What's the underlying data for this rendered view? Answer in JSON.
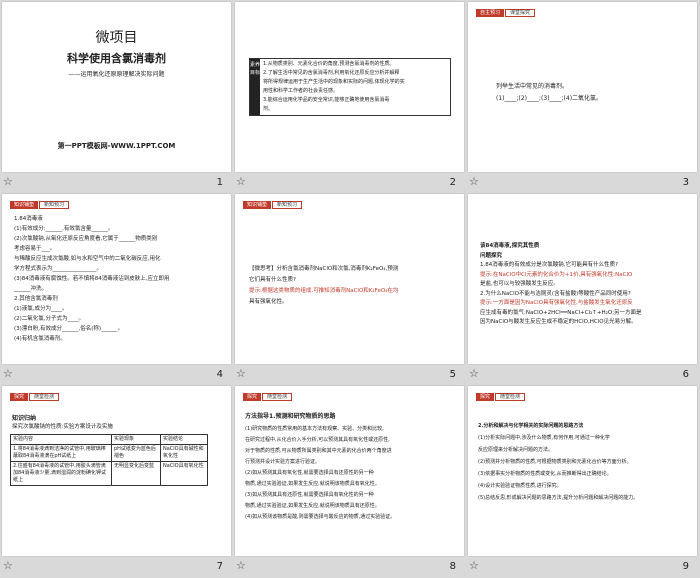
{
  "slides": [
    {
      "number": "1",
      "title": "微项目",
      "subtitle": "科学使用含氯消毒剂",
      "tagline": "——运用氧化还原原理解决实际问题",
      "footer": "第一PPT模板网-WWW.1PPT.COM"
    },
    {
      "number": "2",
      "side_label": "素养目标",
      "lines": [
        "1.从物质类别、元素化合价的角度,预测含氯消毒剂的性质。",
        "2.了解生活中常见的含氯消毒剂,利用氧化还原反应分析并解释",
        "将所得规律运用于生产生活中的现象和实际的问题,体现化学的实",
        "用性和科学工作者的社会责任感。",
        "3.能综合运用化学品的安全常识,能够正确地使用含氯消毒",
        "剂。"
      ]
    },
    {
      "number": "3",
      "tags": [
        "自主预习",
        "课堂探究"
      ],
      "lines": [
        "列举生活中常见的消毒剂。",
        "(1)____;(2)____;(3)____;(4)二氧化氯。"
      ]
    },
    {
      "number": "4",
      "tags": [
        "知识铺垫",
        "新知预习"
      ],
      "lines": [
        "1.84消毒液",
        "(1)有效成分:______,有效氯含量______。",
        "(2)次氯酸钠,从氧化还原反应角度看,它属于______物质类别",
        "考虑容易于___。",
        "与稀酸反应生成次氯酸,如与水和空气中的二氧化碳反应,用化",
        "学方程式表示为________________。",
        "(3)84消毒液有腐蚀性。若不慎将84消毒液沾到皮肤上,应立即用",
        "______冲洗。",
        "2.其他含氯消毒剂",
        "(1)液氯,成分为____。",
        "(2)二氧化氯,分子式为____。",
        "(3)漂白粉,有效成分______,俗名(称)______。",
        "(4)有机含氯消毒剂。"
      ]
    },
    {
      "number": "5",
      "tags": [
        "知识铺垫",
        "新知预习"
      ],
      "lines": [
        "【微思考】分析含氯消毒剂NaClO和次氯,消毒剂K₂FeO₄,预测",
        "它们具有什么性质?",
        "提示:根据这类物质的组成,可推知消毒剂NaClO和K₂FeO₄在均",
        "具有强氧化性。"
      ]
    },
    {
      "number": "6",
      "lines": [
        "该84消毒液,探究其性质",
        "问题探究",
        "1.84消毒液的有效成分是次氯酸钠,它可能具有什么性质?",
        "提示:在NaClO中Cl元素的化合价为+1价,具有强氧化性;NaClO",
        "是盐,也可以与较强酸发生反应。",
        "2.为什么NaClO不能与洁厕灵(含有盐酸)等酸性产品同时使用?",
        "提示:一方面是因为NaClO具有强氧化性,与盐酸发生氧化还原反",
        "应生成有毒的氯气:NaClO+2HCl══NaCl+Cl₂↑+H₂O;另一方面是",
        "因为NaClO与酸发生反应生成不稳定的HClO,HClO见光易分解。"
      ]
    },
    {
      "number": "7",
      "tags": [
        "探究",
        "随堂检测"
      ],
      "heading": "知识归纳",
      "subheading": "探究次氯酸钠的性质:实验方案设计及实施",
      "table": {
        "headers": [
          "实验内容",
          "实验现象",
          "实验结论"
        ],
        "rows": [
          [
            "1.将84消毒液滴到洁净的试管中,用玻璃棒蘸取84消毒液滴在pH试纸上",
            "pH试纸变为蓝色后褪色",
            "NaClO具有碱性和氧化性"
          ],
          [
            "2.往盛有84消毒液的试管中,用胶头滴管滴加84消毒液少量,滴到湿润的淀粉碘化钾试纸上",
            "无明显变化后变蓝",
            "NaClO具有氧化性"
          ]
        ]
      }
    },
    {
      "number": "8",
      "tags": [
        "探究",
        "随堂检测"
      ],
      "heading": "方法指导1.预测和研究物质的思路",
      "lines": [
        "(1)研究物质的性质常用的基本方法有观察、实验、分类和比较,",
        "在研究过程中,从化合价入手分析,可以预测其具有氧化性或还原性,",
        "对于物质的性质,可从物质所属类别和其中元素的化合价两个角度进",
        "行预测并设计实验方案进行验证。",
        "(2)如从预测其具有氧化性,就需要选择具有还原性的另一种",
        "物质,通过实验验证,如果发生反应,就说明该物质具有氧化性。",
        "(3)如从预测其具有还原性,就需要选择具有氧化性的另一种",
        "物质,通过实验验证,如果发生反应,就说明该物质具有还原性。",
        "(4)如从预测该物质是酸,则需要选择与酸反应的物质,通过实验验证。"
      ]
    },
    {
      "number": "9",
      "tags": [
        "探究",
        "随堂检测"
      ],
      "lines": [
        "2.分析和解决与化学相关的实际问题的思路方法",
        "(1)分析实际问题中,涉及什么物质,有何作用,可通过一种化学",
        "反应原理来分析解决问题的方法。",
        "(2)预测并分析物质的性质,可根据物质类别和元素化合价等方面分析。",
        "(3)依据事实分析物质的性质或变化,从而推断得出正确结论。",
        "(4)设计实验验证物质性质,进行探究。",
        "(5)总结反思,形成解决问题的思路方法,提升分析问题和解决问题的能力。"
      ]
    }
  ]
}
